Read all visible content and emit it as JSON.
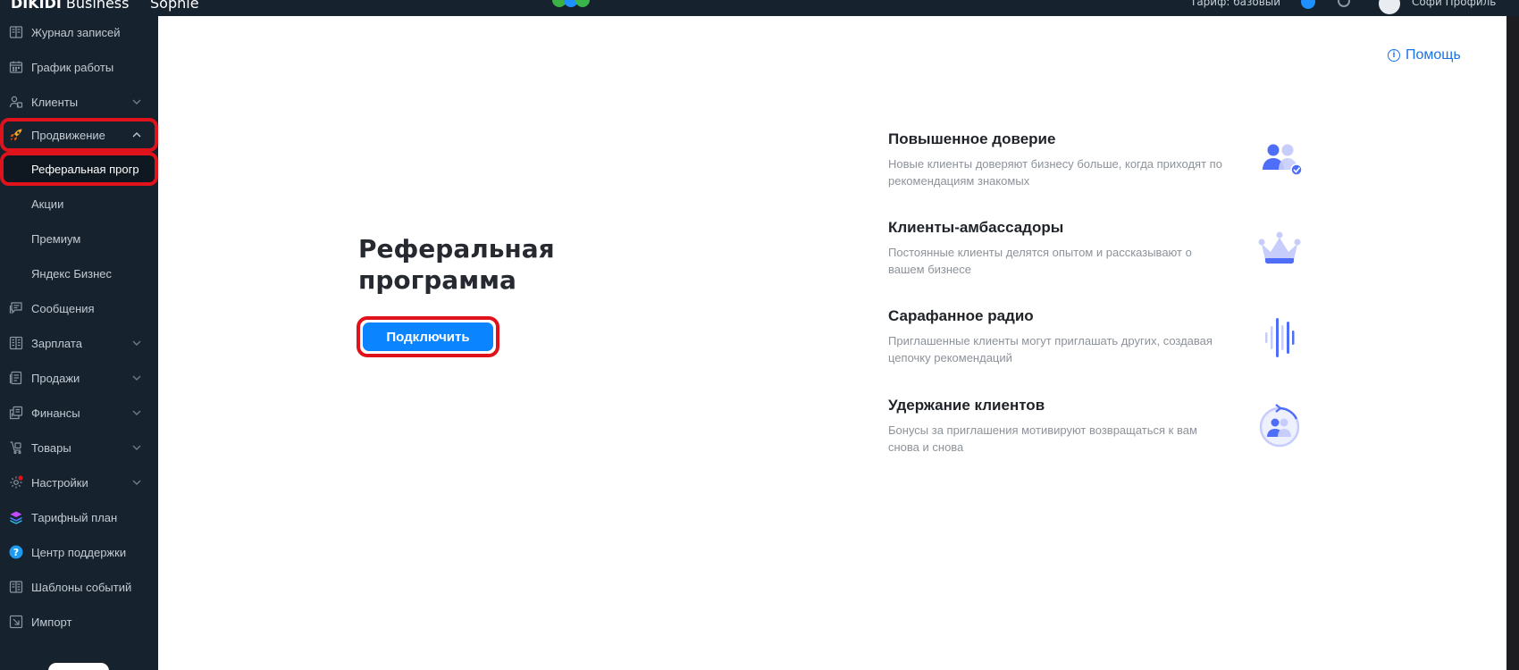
{
  "topbar": {
    "brand": "DIKIDI",
    "brand_sub": " Business",
    "user_label": "Sophie",
    "right_text": "Тариф: базовый",
    "account_name": "Софи Профиль"
  },
  "sidebar": {
    "items": [
      {
        "label": "Журнал записей",
        "icon": "journal-icon"
      },
      {
        "label": "График работы",
        "icon": "calendar-icon"
      },
      {
        "label": "Клиенты",
        "icon": "clients-icon"
      },
      {
        "label": "Продвижение",
        "icon": "rocket-icon"
      },
      {
        "label": "Реферальная прогр"
      },
      {
        "label": "Акции"
      },
      {
        "label": "Премиум"
      },
      {
        "label": "Яндекс Бизнес"
      },
      {
        "label": "Сообщения",
        "icon": "messages-icon"
      },
      {
        "label": "Зарплата",
        "icon": "salary-icon"
      },
      {
        "label": "Продажи",
        "icon": "sales-icon"
      },
      {
        "label": "Финансы",
        "icon": "finance-icon"
      },
      {
        "label": "Товары",
        "icon": "goods-icon"
      },
      {
        "label": "Настройки",
        "icon": "settings-icon"
      },
      {
        "label": "Тарифный план",
        "icon": "layers-icon"
      },
      {
        "label": "Центр поддержки",
        "icon": "help-circle-icon"
      },
      {
        "label": "Шаблоны событий",
        "icon": "templates-icon"
      },
      {
        "label": "Импорт",
        "icon": "import-icon"
      }
    ]
  },
  "main": {
    "help_label": "Помощь",
    "title": "Реферальная программа",
    "connect_label": "Подключить",
    "features": [
      {
        "title": "Повышенное доверие",
        "desc": "Новые клиенты доверяют бизнесу больше, когда приходят по рекомендациям знакомых",
        "icon": "trust-people-icon"
      },
      {
        "title": "Клиенты-амбассадоры",
        "desc": "Постоянные клиенты делятся опытом и рассказывают о вашем бизнесе",
        "icon": "crown-icon"
      },
      {
        "title": "Сарафанное радио",
        "desc": "Приглашенные клиенты могут приглашать других, создавая цепочку рекомендаций",
        "icon": "sound-wave-icon"
      },
      {
        "title": "Удержание клиентов",
        "desc": "Бонусы за приглашения мотивируют возвращаться к вам снова и снова",
        "icon": "retention-icon"
      }
    ]
  },
  "colors": {
    "sidebar_bg": "#16222d",
    "accent": "#0a84ff",
    "highlight": "#e0121b"
  }
}
